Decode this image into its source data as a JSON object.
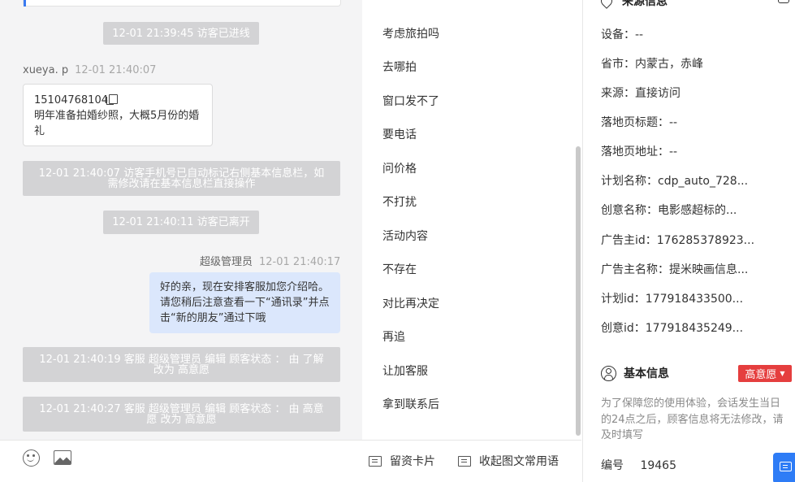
{
  "chat": {
    "sys1": "12-01 21:39:45 访客已进线",
    "visitor_name": "xueya. p",
    "visitor_time": "12-01 21:40:07",
    "visitor_phone": "15104768104",
    "visitor_msg": "明年准备拍婚纱照，大概5月份的婚礼",
    "sys2": "12-01 21:40:07 访客手机号已自动标记右侧基本信息栏，如需修改请在基本信息栏直接操作",
    "sys3": "12-01 21:40:11 访客已离开",
    "agent_name": "超级管理员",
    "agent_time": "12-01 21:40:17",
    "agent_msg": "好的亲，现在安排客服加您介绍哈。请您稍后注意查看一下“通讯录”并点击“新的朋友”通过下哦",
    "sys4": "12-01 21:40:19 客服 超级管理员 编辑 顾客状态 ： 由 了解 改为 高意愿",
    "sys5": "12-01 21:40:27 客服 超级管理员 编辑 顾客状态 ： 由 高意愿 改为 高意愿"
  },
  "toolbar": {
    "leave_card": "留资卡片",
    "collapse_phrases": "收起图文常用语"
  },
  "phrases": [
    "考虑旅拍吗",
    "去哪拍",
    "窗口发不了",
    "要电话",
    "问价格",
    "不打扰",
    "活动内容",
    "不存在",
    "对比再决定",
    "再追",
    "让加客服",
    "拿到联系后"
  ],
  "info": {
    "source_title": "来源信息",
    "device": "设备：--",
    "province": "省市：内蒙古，赤峰",
    "source": "来源：直接访问",
    "landing_title": "落地页标题：--",
    "landing_url": "落地页地址：--",
    "plan_name": "计划名称：cdp_auto_728...",
    "creative_name": "创意名称：电影感超标的...",
    "advertiser_id": "广告主id：176285378923...",
    "advertiser_name": "广告主名称：提米映画信息...",
    "plan_id": "计划id：177918433500...",
    "creative_id": "创意id：177918435249...",
    "basic_title": "基本信息",
    "intent_badge": "高意愿",
    "notice": "为了保障您的使用体验，会话发生当日的24点之后，顾客信息将无法修改，请及时填写",
    "number_label": "编号",
    "number_value": "19465"
  },
  "colors": {
    "accent_blue": "#2e7cf6",
    "badge_red": "#e53e3e",
    "agent_bubble": "#dbe7fc",
    "system_pill": "#d3d3d5"
  }
}
